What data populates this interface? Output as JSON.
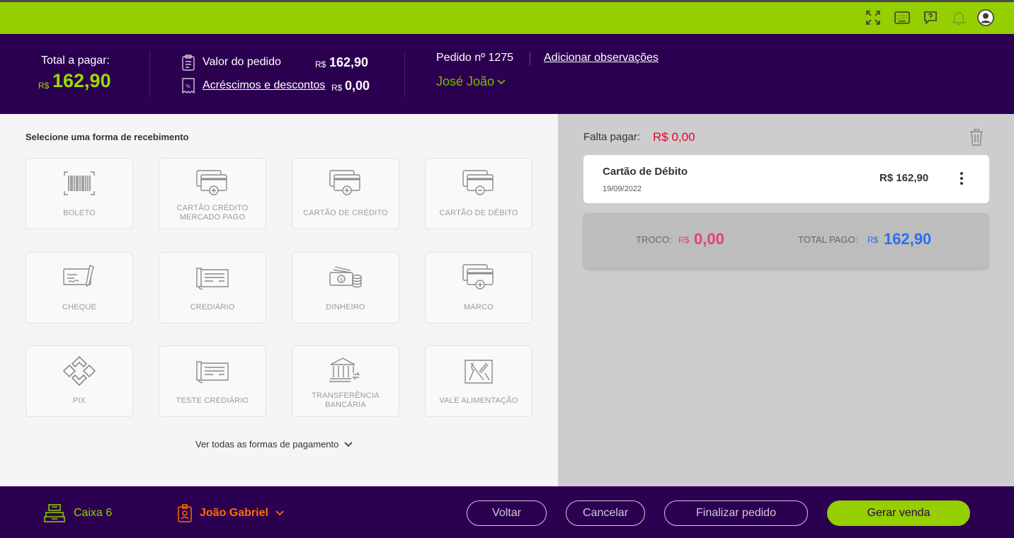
{
  "topbar": {
    "icons": [
      "fullscreen-icon",
      "keyboard-icon",
      "help-chat-icon",
      "bell-icon",
      "user-avatar-icon"
    ]
  },
  "header": {
    "total_label": "Total a pagar:",
    "total_currency": "R$",
    "total_value": "162,90",
    "valor_pedido_label": "Valor do pedido",
    "valor_pedido_currency": "R$",
    "valor_pedido_value": "162,90",
    "acrescimos_label": "Acréscimos e descontos",
    "acrescimos_currency": "R$",
    "acrescimos_value": "0,00",
    "pedido_label": "Pedido nº 1275",
    "observacoes_link": "Adicionar observações",
    "cliente": "José João"
  },
  "payment_methods": {
    "title": "Selecione uma forma de recebimento",
    "items": [
      {
        "label": "BOLETO",
        "icon": "barcode-icon"
      },
      {
        "label": "CARTÃO CRÉDITO MERCADO PAGO",
        "icon": "credit-card-plus-icon"
      },
      {
        "label": "CARTÃO DE CRÉDITO",
        "icon": "credit-card-plus-icon"
      },
      {
        "label": "CARTÃO DE DÉBITO",
        "icon": "debit-card-minus-icon"
      },
      {
        "label": "CHEQUE",
        "icon": "cheque-icon"
      },
      {
        "label": "CREDIÁRIO",
        "icon": "crediario-icon"
      },
      {
        "label": "DINHEIRO",
        "icon": "cash-icon"
      },
      {
        "label": "MARCO",
        "icon": "credit-card-plus-icon"
      },
      {
        "label": "PIX",
        "icon": "pix-icon"
      },
      {
        "label": "TESTE CREDIÁRIO",
        "icon": "crediario-icon"
      },
      {
        "label": "TRANSFERÊNCIA BANCÁRIA",
        "icon": "bank-transfer-icon"
      },
      {
        "label": "VALE ALIMENTAÇÃO",
        "icon": "food-voucher-icon"
      }
    ],
    "ver_todas": "Ver todas as formas de pagamento"
  },
  "summary_panel": {
    "falta_label": "Falta pagar:",
    "falta_value": "R$ 0,00",
    "payment": {
      "name": "Cartão de Débito",
      "date": "19/09/2022",
      "value": "R$ 162,90"
    },
    "troco_label": "TROCO:",
    "troco_currency": "R$",
    "troco_value": "0,00",
    "total_pago_label": "TOTAL PAGO:",
    "total_pago_currency": "R$",
    "total_pago_value": "162,90"
  },
  "footer": {
    "caixa": "Caixa 6",
    "operador": "João Gabriel",
    "voltar": "Voltar",
    "cancelar": "Cancelar",
    "finalizar": "Finalizar pedido",
    "gerar_venda": "Gerar venda"
  },
  "colors": {
    "brand_green": "#95cf00",
    "brand_purple": "#2c0050",
    "alert_red": "#e8002a",
    "troco_pink": "#e04080",
    "total_blue": "#2a6ff0",
    "operator_orange": "#ff6a00"
  }
}
